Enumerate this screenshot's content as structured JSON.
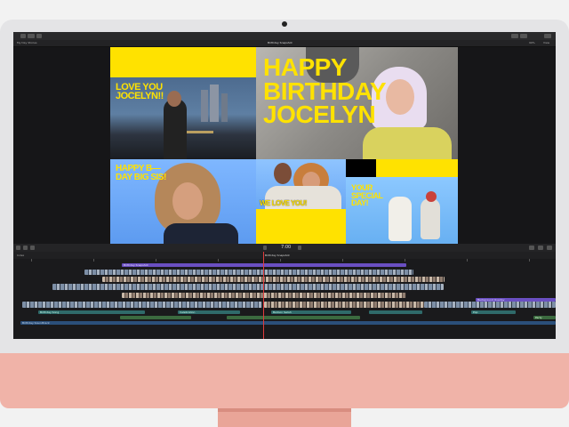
{
  "app": {
    "window_title": "Birthday Snapshot",
    "library": "My Day Stories",
    "zoom": "99%",
    "view_label": "View"
  },
  "canvas": {
    "panels": {
      "top_left_text": "LOVE YOU JOCELYN!!",
      "headline": "HAPPY BIRTHDAY JOCELYN",
      "bottom_left_text": "HAPPY B—DAY BIG SIS!",
      "center_bottom_text": "WE LOVE YOU!",
      "bottom_right_text": "YOUR SPECIAL DAY!"
    },
    "colors": {
      "accent_yellow": "#ffe200",
      "sky_blue": "#7fb7ff",
      "dark": "#111111"
    }
  },
  "viewer_controls": {
    "timecode": "7:00"
  },
  "timeline": {
    "header_label": "Birthday Snapshot",
    "index_label": "Index",
    "title_clip": "Birthday Snapshot",
    "top_right_clip": "Background Overlay",
    "audio_left": "Birthday Song",
    "audio_label_2": "Celebration",
    "audio_label_3": "Balloon Swish",
    "audio_label_4": "Pop",
    "bottom_left": "Birthday Soundtrack",
    "bottom_right": "Party"
  }
}
